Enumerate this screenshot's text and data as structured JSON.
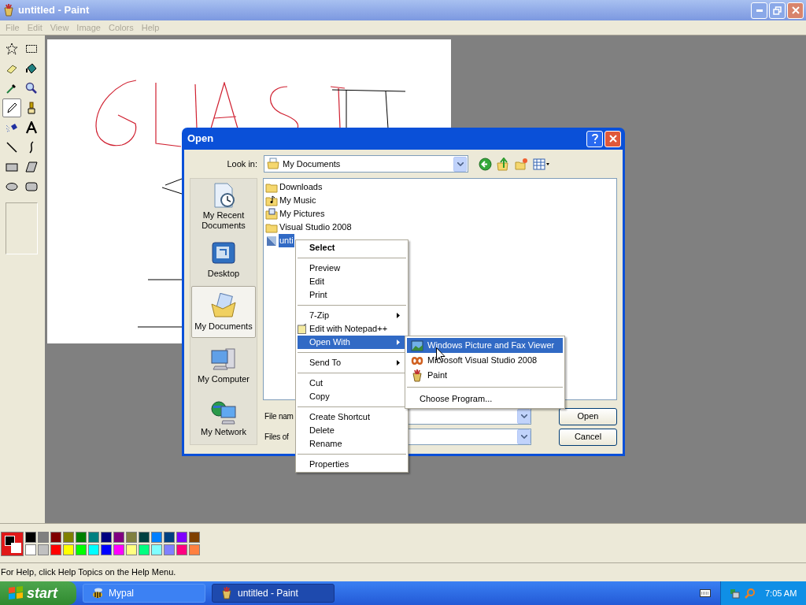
{
  "window": {
    "title": "untitled - Paint",
    "active": false
  },
  "menu": [
    "File",
    "Edit",
    "View",
    "Image",
    "Colors",
    "Help"
  ],
  "tools": [
    {
      "kind": "free-select",
      "selected": false
    },
    {
      "kind": "rect-select",
      "selected": false
    },
    {
      "kind": "eraser",
      "selected": false
    },
    {
      "kind": "fill",
      "selected": false
    },
    {
      "kind": "picker",
      "selected": false
    },
    {
      "kind": "magnifier",
      "selected": false
    },
    {
      "kind": "pencil",
      "selected": true
    },
    {
      "kind": "brush",
      "selected": false
    },
    {
      "kind": "airbrush",
      "selected": false
    },
    {
      "kind": "text",
      "selected": false
    },
    {
      "kind": "line",
      "selected": false
    },
    {
      "kind": "curve",
      "selected": false
    },
    {
      "kind": "rectangle",
      "selected": false
    },
    {
      "kind": "polygon",
      "selected": false
    },
    {
      "kind": "ellipse",
      "selected": false
    },
    {
      "kind": "rounded-rectangle",
      "selected": false
    }
  ],
  "palette": {
    "current": [
      {
        "color": "#000000"
      },
      {
        "color": "#ffffff"
      }
    ],
    "colors": [
      {
        "color": "#000000"
      },
      {
        "color": "#808080"
      },
      {
        "color": "#800000"
      },
      {
        "color": "#808000"
      },
      {
        "color": "#008000"
      },
      {
        "color": "#008080"
      },
      {
        "color": "#000080"
      },
      {
        "color": "#800080"
      },
      {
        "color": "#808040"
      },
      {
        "color": "#004040"
      },
      {
        "color": "#0080ff"
      },
      {
        "color": "#004080"
      },
      {
        "color": "#8000ff"
      },
      {
        "color": "#804000"
      },
      {
        "color": "#ffffff"
      },
      {
        "color": "#c0c0c0"
      },
      {
        "color": "#ff0000"
      },
      {
        "color": "#ffff00"
      },
      {
        "color": "#00ff00"
      },
      {
        "color": "#00ffff"
      },
      {
        "color": "#0000ff"
      },
      {
        "color": "#ff00ff"
      },
      {
        "color": "#ffff80"
      },
      {
        "color": "#00ff80"
      },
      {
        "color": "#80ffff"
      },
      {
        "color": "#8080ff"
      },
      {
        "color": "#ff0080"
      },
      {
        "color": "#ff8040"
      }
    ]
  },
  "status_bar": "For Help, click Help Topics on the Help Menu.",
  "dialog": {
    "title": "Open",
    "look_in_label": "Look in:",
    "look_in": "My Documents",
    "places": [
      {
        "label": "My Recent Documents",
        "kind": "recent",
        "selected": false
      },
      {
        "label": "Desktop",
        "kind": "desktop",
        "selected": false
      },
      {
        "label": "My Documents",
        "kind": "documents",
        "selected": true
      },
      {
        "label": "My Computer",
        "kind": "computer",
        "selected": false
      },
      {
        "label": "My Network",
        "kind": "network",
        "selected": false
      }
    ],
    "files": [
      {
        "name": "Downloads",
        "kind": "folder",
        "selected": false
      },
      {
        "name": "My Music",
        "kind": "music",
        "selected": false
      },
      {
        "name": "My Pictures",
        "kind": "pictures",
        "selected": false
      },
      {
        "name": "Visual Studio 2008",
        "kind": "folder",
        "selected": false
      },
      {
        "name": "unti",
        "kind": "image",
        "selected": true
      }
    ],
    "file_name_label": "File nam",
    "file_type_label": "Files of",
    "buttons": [
      "Open",
      "Cancel"
    ]
  },
  "context_menu": {
    "groups": [
      [
        {
          "label": "Select",
          "kind": "default",
          "selected": false
        }
      ],
      [
        {
          "label": "Preview",
          "kind": "item",
          "selected": false
        },
        {
          "label": "Edit",
          "kind": "item",
          "selected": false
        },
        {
          "label": "Print",
          "kind": "item",
          "selected": false
        }
      ],
      [
        {
          "label": "7-Zip",
          "kind": "submenu",
          "selected": false
        },
        {
          "label": "Edit with Notepad++",
          "kind": "icon",
          "selected": false
        },
        {
          "label": "Open With",
          "kind": "submenu",
          "selected": true
        }
      ],
      [
        {
          "label": "Send To",
          "kind": "submenu",
          "selected": false
        }
      ],
      [
        {
          "label": "Cut",
          "kind": "item",
          "selected": false
        },
        {
          "label": "Copy",
          "kind": "item",
          "selected": false
        }
      ],
      [
        {
          "label": "Create Shortcut",
          "kind": "item",
          "selected": false
        },
        {
          "label": "Delete",
          "kind": "item",
          "selected": false
        },
        {
          "label": "Rename",
          "kind": "item",
          "selected": false
        }
      ],
      [
        {
          "label": "Properties",
          "kind": "item",
          "selected": false
        }
      ]
    ]
  },
  "submenu": {
    "groups": [
      [
        {
          "label": "Windows Picture and Fax Viewer",
          "kind": "viewer",
          "selected": true
        },
        {
          "label": "Microsoft Visual Studio 2008",
          "kind": "studio",
          "selected": false
        },
        {
          "label": "Paint",
          "kind": "paint",
          "selected": false
        }
      ],
      [
        {
          "label": "Choose Program...",
          "kind": "item",
          "selected": false
        }
      ]
    ]
  },
  "taskbar": {
    "start": "start",
    "tasks": [
      {
        "label": "Mypal",
        "kind": "browser",
        "selected": false
      },
      {
        "label": "untitled - Paint",
        "kind": "paint",
        "selected": true
      }
    ],
    "clock": "7:05 AM"
  }
}
